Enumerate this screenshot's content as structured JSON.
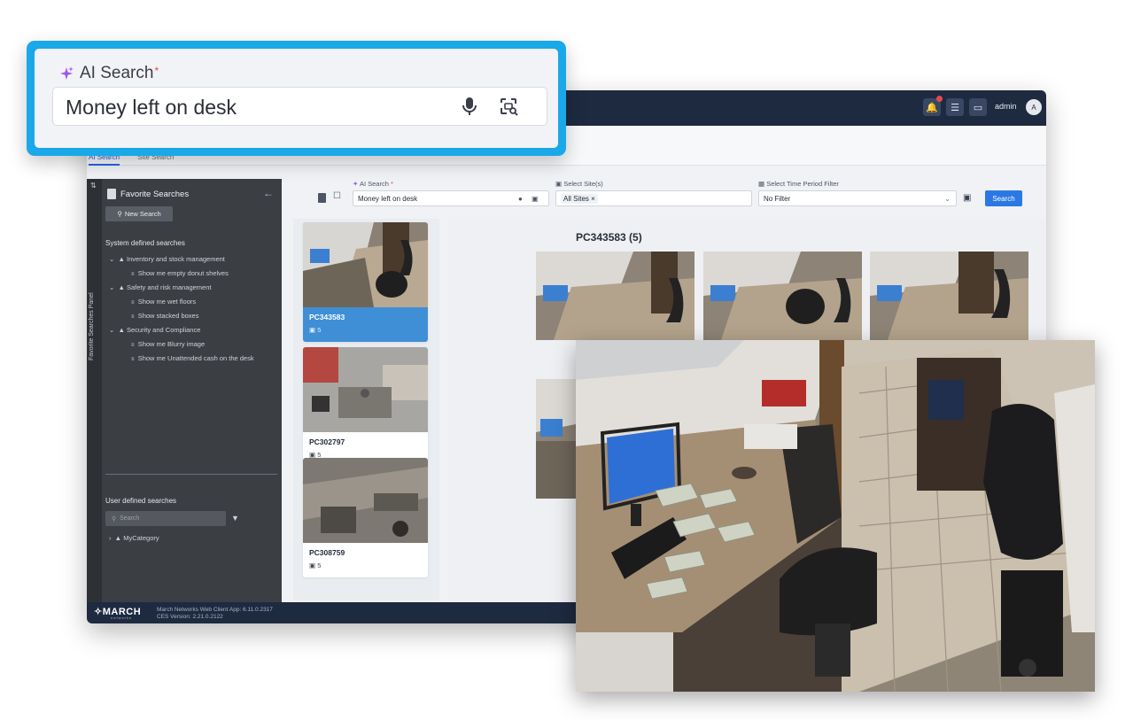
{
  "topbar": {
    "user": "admin",
    "avatar": "A"
  },
  "tabs": [
    {
      "label": "AI Search"
    },
    {
      "label": "Site Search"
    }
  ],
  "sidebar": {
    "vertical_label": "Favorite Searches Panel",
    "title": "Favorite Searches",
    "new_search": "New Search",
    "system_section": "System defined searches",
    "categories": [
      {
        "label": "Inventory and stock management",
        "items": [
          "Show me empty donut shelves"
        ]
      },
      {
        "label": "Safety and risk management",
        "items": [
          "Show me wet floors",
          "Show stacked boxes"
        ]
      },
      {
        "label": "Security and Compliance",
        "items": [
          "Show me Blurry image",
          "Show me Unattended cash on the desk"
        ]
      }
    ],
    "user_section": "User defined searches",
    "search_placeholder": "Search",
    "user_category": "MyCategory"
  },
  "searchbar": {
    "ai_label": "AI Search",
    "ai_value": "Money left on desk",
    "site_label": "Select Site(s)",
    "site_value": "All Sites",
    "time_label": "Select Time Period Filter",
    "time_value": "No Filter",
    "button": "Search"
  },
  "cards": [
    {
      "title": "PC343583",
      "count": "5",
      "active": true
    },
    {
      "title": "PC302797",
      "count": "5",
      "active": false
    },
    {
      "title": "PC308759",
      "count": "5",
      "active": false
    }
  ],
  "results": {
    "title": "PC343583 (5)"
  },
  "footer": {
    "logo": "MARCH",
    "logo_sub": "networks",
    "logo_tag": "A Delta Group Company",
    "version_line1": "March Networks Web Client App: 6.11.0.2317",
    "version_line2": "CES Version: 2.21.0.2122"
  },
  "callout": {
    "label": "AI Search",
    "required_mark": "*",
    "value": "Money left on desk"
  },
  "colors": {
    "accent": "#2b78e4",
    "callout_border": "#1aa8e8",
    "topbar": "#1e2a40",
    "sidebar": "#3b3f44"
  }
}
